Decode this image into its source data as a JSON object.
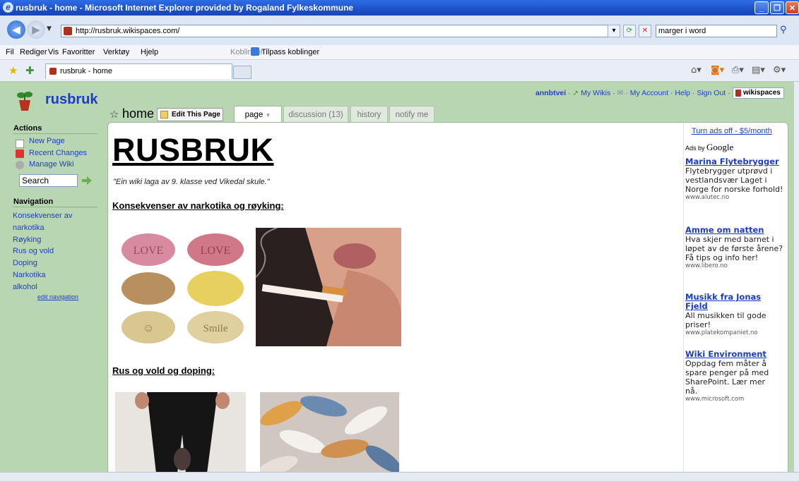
{
  "window": {
    "title": "rusbruk - home - Microsoft Internet Explorer provided by Rogaland Fylkeskommune"
  },
  "browser": {
    "address": "http://rusbruk.wikispaces.com/",
    "search_value": "marger i word",
    "menu": [
      "Fil",
      "Rediger",
      "Vis",
      "Favoritter",
      "Verktøy",
      "Hjelp"
    ],
    "links_label": "Koblinger",
    "customize_links": "Tilpass koblinger",
    "tab_title": "rusbruk - home"
  },
  "wiki": {
    "name": "rusbruk",
    "user": "annbtvei",
    "topnav": [
      "My Wikis",
      "My Account",
      "Help",
      "Sign Out"
    ],
    "badge": "wikispaces"
  },
  "sidebar": {
    "actions_heading": "Actions",
    "actions": [
      "New Page",
      "Recent Changes",
      "Manage Wiki"
    ],
    "search_value": "Search",
    "navigation_heading": "Navigation",
    "nav_items": [
      "Konsekvenser av",
      "narkotika",
      "Røyking",
      "Rus og vold",
      "Doping",
      "Narkotika",
      "alkohol"
    ],
    "edit_navigation": "edit navigation"
  },
  "page": {
    "name": "home",
    "edit_label": "Edit This Page",
    "tabs": [
      "page",
      "discussion (13)",
      "history",
      "notify me"
    ],
    "heading": "RUSBRUK",
    "tagline": "\"Ein wiki laga av 9. klasse ved Vikedal skule.\"",
    "section1": "Konsekvenser av narkotika og røyking:",
    "section2": "Rus og vold og doping:",
    "pill_labels": [
      "LOVE",
      "LOVE",
      "Smile"
    ]
  },
  "ads": {
    "turn_off": "Turn ads off - $5/month",
    "ads_by": "Ads by",
    "google": "Google",
    "items": [
      {
        "title": "Marina Flytebrygger",
        "body": "Flytebrygger utprøvd i vestlandsvær Laget i Norge for norske forhold!",
        "url": "www.alutec.no"
      },
      {
        "title": "Amme om natten",
        "body": "Hva skjer med barnet i løpet av de første årene? Få tips og info her!",
        "url": "www.libero.no"
      },
      {
        "title": "Musikk fra Jonas Fjeld",
        "body": "All musikken til gode priser!",
        "url": "www.platekompaniet.no"
      },
      {
        "title": "Wiki Environment",
        "body": "Oppdag fem måter å spare penger på med SharePoint. Lær mer nå.",
        "url": "www.microsoft.com"
      }
    ]
  },
  "colors": {
    "page_bg": "#b9d6b3",
    "link": "#2040c8",
    "titlebar": "#1c50c8"
  }
}
